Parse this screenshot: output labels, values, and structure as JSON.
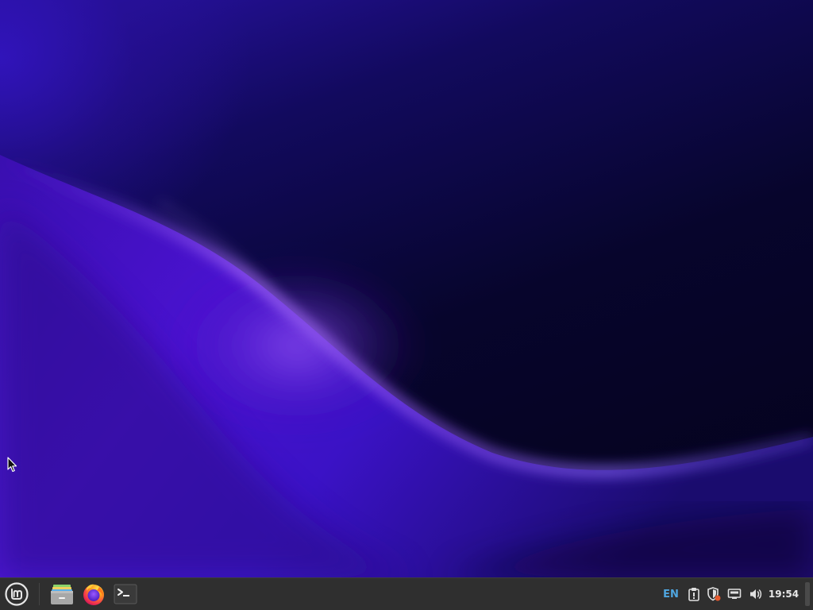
{
  "desktop": {
    "wallpaper": "purple-wave-wallpaper",
    "cursor_icon": "arrow-cursor-icon"
  },
  "taskbar": {
    "menu_button": {
      "icon": "linux-mint-logo-icon"
    },
    "launchers": [
      {
        "name": "files",
        "icon": "folder-icon"
      },
      {
        "name": "firefox",
        "icon": "firefox-icon"
      },
      {
        "name": "terminal",
        "icon": "terminal-icon"
      }
    ],
    "tray": {
      "keyboard_layout": "EN",
      "icons": [
        "clipboard-icon",
        "shield-update-icon",
        "network-icon",
        "volume-icon"
      ],
      "clock": "19:54"
    }
  },
  "colors": {
    "taskbar_bg": "#2f2f2f",
    "keyboard_layout_text": "#4fa6e0",
    "clock_text": "#e8e8e8",
    "wallpaper_accent": "#7a3cf0"
  }
}
